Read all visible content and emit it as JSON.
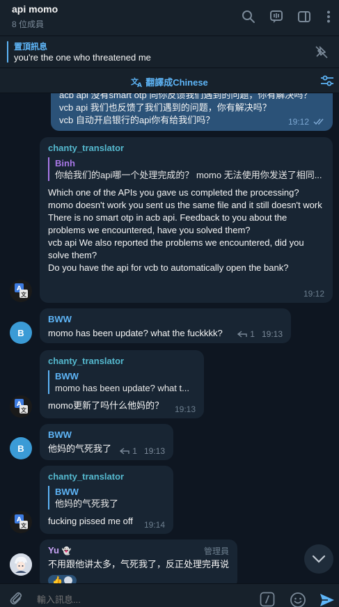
{
  "header": {
    "title": "api momo",
    "subtitle": "8 位成員"
  },
  "pinned": {
    "title": "置頂訊息",
    "text": "you're the one who threatened me"
  },
  "translate": {
    "label": "翻譯成Chinese"
  },
  "messages": {
    "m0": {
      "text": "acb api 没有smart otp 向你反馈我们遇到的问题，你有解决吗？\nvcb api 我们也反馈了我们遇到的问题，你有解决吗？\nvcb 自动开启银行的api你有给我们吗？",
      "time": "19:12"
    },
    "m1": {
      "sender": "chanty_translator",
      "reply_name": "Binh",
      "reply_text": "你給我们的api哪一个处理完成的？ momo 无法使用你发送了相同...",
      "text": "Which one of the APIs you gave us completed the processing?\nmomo doesn't work you sent us the same file and it still doesn't work\nThere is no smart otp in acb api. Feedback to you about the problems we encountered, have you solved them?\nvcb api We also reported the problems we encountered, did you solve them?\nDo you have the api for vcb to automatically open the bank?",
      "time": "19:12",
      "avatar_text": "A文"
    },
    "m2": {
      "sender": "BWW",
      "text": "momo has been update? what the fuckkkk?",
      "reply_count": "1",
      "time": "19:13",
      "avatar_text": "B"
    },
    "m3": {
      "sender": "chanty_translator",
      "reply_name": "BWW",
      "reply_text": "momo has been update? what t...",
      "text": "momo更新了吗什么他妈的？",
      "time": "19:13",
      "avatar_text": "A文"
    },
    "m4": {
      "sender": "BWW",
      "text": "他妈的气死我了",
      "reply_count": "1",
      "time": "19:13",
      "avatar_text": "B"
    },
    "m5": {
      "sender": "chanty_translator",
      "reply_name": "BWW",
      "reply_text": "他妈的气死我了",
      "text": "fucking pissed me off",
      "time": "19:14",
      "avatar_text": "A文"
    },
    "m6": {
      "sender": "Yu",
      "badge": "管理員",
      "text": "不用跟他讲太多，气死我了，反正处理完再说"
    }
  },
  "composer": {
    "placeholder": "輸入訊息..."
  },
  "colors": {
    "background": "#0e1621",
    "panel": "#17212b",
    "accent": "#5eb5f7",
    "bubble_in": "#182533",
    "bubble_out": "#2b5278"
  }
}
